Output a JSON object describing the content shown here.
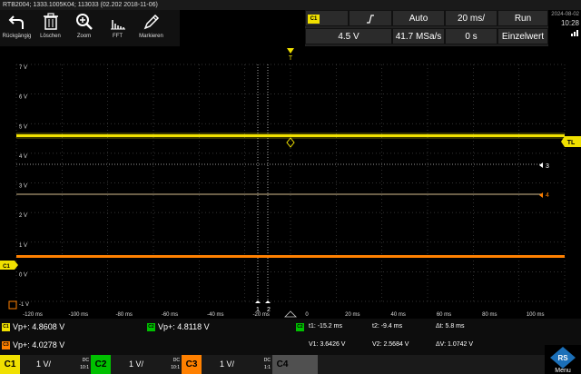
{
  "title": "RTB2004; 1333.1005K04; 113033 (02.202 2018-11-06)",
  "toolbar": [
    {
      "label": "Rückgängig",
      "icon": "undo-icon"
    },
    {
      "label": "Löschen",
      "icon": "trash-icon"
    },
    {
      "label": "Zoom",
      "icon": "zoom-icon"
    },
    {
      "label": "FFT",
      "icon": "fft-icon"
    },
    {
      "label": "Markieren",
      "icon": "pen-icon"
    }
  ],
  "trigger": {
    "channel": "C1",
    "slope_icon": "rising-edge-icon",
    "mode": "Auto",
    "timebase": "20 ms/",
    "run_state": "Run",
    "level": "4.5 V",
    "sample_rate": "41.7 MSa/s",
    "position": "0 s",
    "acq_mode": "Einzelwert"
  },
  "datetime": {
    "date": "2024-08-02",
    "time": "10:28"
  },
  "y_ticks": [
    "7 V",
    "6 V",
    "5 V",
    "4 V",
    "3 V",
    "2 V",
    "1 V",
    "0 V",
    "-1 V"
  ],
  "x_ticks": [
    "-120 ms",
    "-100 ms",
    "-80 ms",
    "-60 ms",
    "-40 ms",
    "-20 ms",
    "0",
    "20 ms",
    "40 ms",
    "60 ms",
    "80 ms",
    "100 ms"
  ],
  "markers": {
    "tl": "TL",
    "ch3": "3",
    "ch4": "4",
    "ch1_ground": "C1",
    "cursor1": "1",
    "cursor2": "2"
  },
  "colors": {
    "ch1": "#f0e000",
    "ch2": "#00c000",
    "ch3": "#ff8000",
    "ch4": "#808080"
  },
  "measurements": {
    "c1": "Vp+: 4.8608 V",
    "c2": "Vp+: 4.8118 V",
    "c3": "Vp+: 4.0278 V"
  },
  "cursors": {
    "t1": "t1: -15.2 ms",
    "t2": "t2: -9.4 ms",
    "dt": "Δt: 5.8 ms",
    "v1": "V1: 3.6426 V",
    "v2": "V2: 2.5684 V",
    "dv": "ΔV: 1.0742 V"
  },
  "channels": [
    {
      "name": "C1",
      "scale": "1 V/",
      "coupling": "DC",
      "probe": "10:1"
    },
    {
      "name": "C2",
      "scale": "1 V/",
      "coupling": "DC",
      "probe": "10:1"
    },
    {
      "name": "C3",
      "scale": "1 V/",
      "coupling": "DC",
      "probe": "1:1"
    },
    {
      "name": "C4",
      "scale": "",
      "coupling": "",
      "probe": ""
    }
  ],
  "menu_label": "Menu"
}
